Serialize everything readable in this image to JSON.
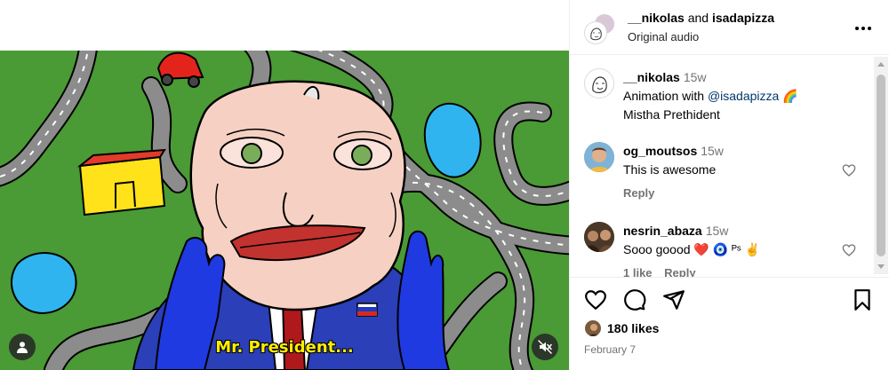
{
  "media": {
    "subtitle": "Mr. President...",
    "tag_icon": "user-tag-icon",
    "mute_icon": "speaker-muted-icon"
  },
  "header": {
    "user1": "__nikolas",
    "joiner": "and",
    "user2": "isadapizza",
    "subtitle": "Original audio",
    "more_icon": "more-horizontal-icon"
  },
  "comments": [
    {
      "user": "__nikolas",
      "time": "15w",
      "text_prefix": "Animation with",
      "mention": "@isadapizza",
      "emoji": "🌈",
      "line2": "Mistha Prethident"
    },
    {
      "user": "og_moutsos",
      "time": "15w",
      "text": "This is awesome",
      "reply": "Reply"
    },
    {
      "user": "nesrin_abaza",
      "time": "15w",
      "text": "Sooo goood",
      "emojis": "❤️ 🧿 ᴾˢ ✌️",
      "likes": "1 like",
      "reply": "Reply"
    }
  ],
  "actions": {
    "like_icon": "heart-icon",
    "comment_icon": "comment-icon",
    "share_icon": "send-icon",
    "save_icon": "bookmark-icon"
  },
  "likes": "180 likes",
  "date": "February 7",
  "colors": {
    "grass": "#4a9a35",
    "road": "#8c8c8c",
    "subtitle": "#ffee00",
    "suit": "#2a3fb8",
    "mention": "#00376b",
    "meta": "#737373"
  }
}
